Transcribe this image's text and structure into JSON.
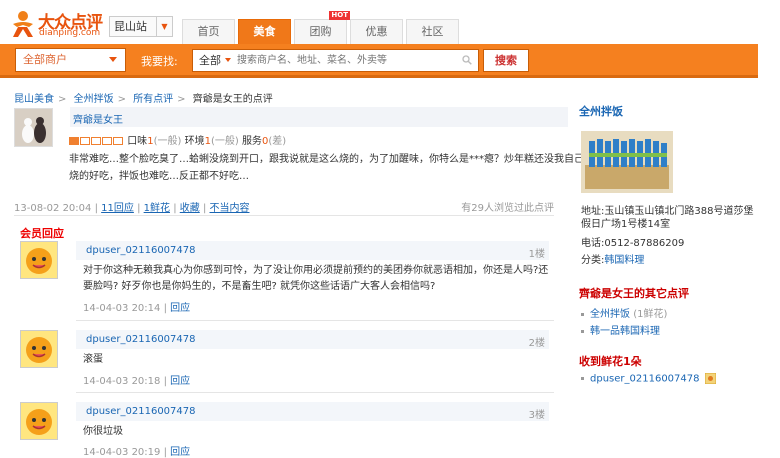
{
  "logo": {
    "title": "大众点评",
    "sub": "dianping.com"
  },
  "city": {
    "label": "昆山站"
  },
  "nav": {
    "tabs": [
      {
        "label": "首页"
      },
      {
        "label": "美食"
      },
      {
        "label": "团购",
        "badge": "HOT"
      },
      {
        "label": "优惠"
      },
      {
        "label": "社区"
      }
    ],
    "active": 1
  },
  "search": {
    "category": "全部商户",
    "want_label": "我要找:",
    "scope": "全部",
    "placeholder": "搜索商户名、地址、菜名、外卖等",
    "button": "搜索"
  },
  "breadcrumb": {
    "items": [
      "昆山美食",
      "全州拌饭",
      "所有点评",
      "齊爺是女王的点评"
    ],
    "sep": ">"
  },
  "review": {
    "author": "齊爺是女王",
    "stars_filled": 1,
    "stars_total": 5,
    "scores": [
      {
        "label": "口味",
        "value": "1",
        "note": "(一般)"
      },
      {
        "label": "环境",
        "value": "1",
        "note": "(一般)"
      },
      {
        "label": "服务",
        "value": "0",
        "note": "(差)"
      }
    ],
    "body": "非常难吃…整个脸吃臭了…蛤蜊没烧到开口，跟我说就是这么烧的，为了加醒味，你特么是***瘪？炒年糕还没我自己烧的好吃，拌饭也难吃…反正都不好吃…",
    "date": "13-08-02 20:04",
    "actions": [
      "11回应",
      "1鲜花",
      "收藏",
      "不当内容"
    ],
    "stat": "有29人浏览过此点评"
  },
  "member_reply_title": "会员回应",
  "replies": [
    {
      "user": "dpuser_02116007478",
      "floor": "1楼",
      "text": "对于你这种无赖我真心为你感到可怜，为了没让你用必须提前预约的美团券你就恶语相加，你还是人吗?还要脸吗? 好歹你也是你妈生的，不是畜生吧? 就凭你这些话语广大客人会相信吗?",
      "date": "14-04-03 20:14",
      "action": "回应"
    },
    {
      "user": "dpuser_02116007478",
      "floor": "2楼",
      "text": "滚蛋",
      "date": "14-04-03 20:18",
      "action": "回应"
    },
    {
      "user": "dpuser_02116007478",
      "floor": "3楼",
      "text": "你很垃圾",
      "date": "14-04-03 20:19",
      "action": "回应"
    }
  ],
  "sidebar": {
    "shop_name": "全州拌饭",
    "address_label": "地址:",
    "address": "玉山镇玉山镇北门路388号道莎堡假日广场1号楼14室",
    "phone_label": "电话:",
    "phone": "0512-87886209",
    "category_label": "分类:",
    "category": "韩国料理",
    "other_reviews_title": "齊爺是女王的其它点评",
    "other_reviews": [
      {
        "name": "全州拌饭",
        "note": "(1鲜花)"
      },
      {
        "name": "韩一品韩国料理",
        "note": ""
      }
    ],
    "flowers_title": "收到鲜花1朵",
    "flowers": [
      {
        "name": "dpuser_02116007478"
      }
    ]
  }
}
